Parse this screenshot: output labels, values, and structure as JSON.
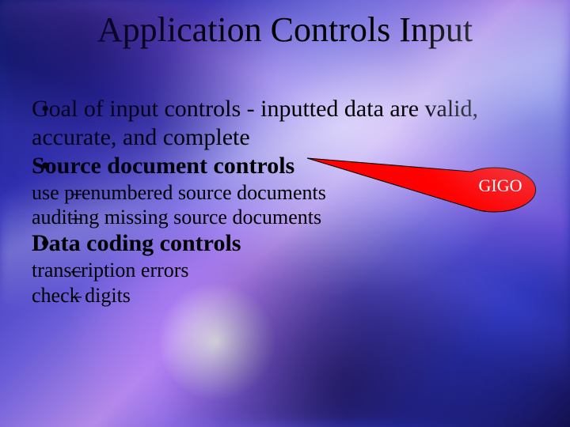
{
  "title": "Application Controls Input",
  "bullets": [
    {
      "text": "Goal of input controls - inputted data are valid, accurate, and complete",
      "bold": false
    },
    {
      "text": "Source document controls",
      "bold": true
    }
  ],
  "sub1": [
    "use prenumbered source documents",
    "auditing missing source documents"
  ],
  "bullets2": [
    {
      "text": "Data coding controls",
      "bold": true
    }
  ],
  "sub2": [
    "transcription errors",
    "check digits"
  ],
  "callout": {
    "label": "GIGO",
    "fill": "#ff0000",
    "stroke": "#000000"
  }
}
